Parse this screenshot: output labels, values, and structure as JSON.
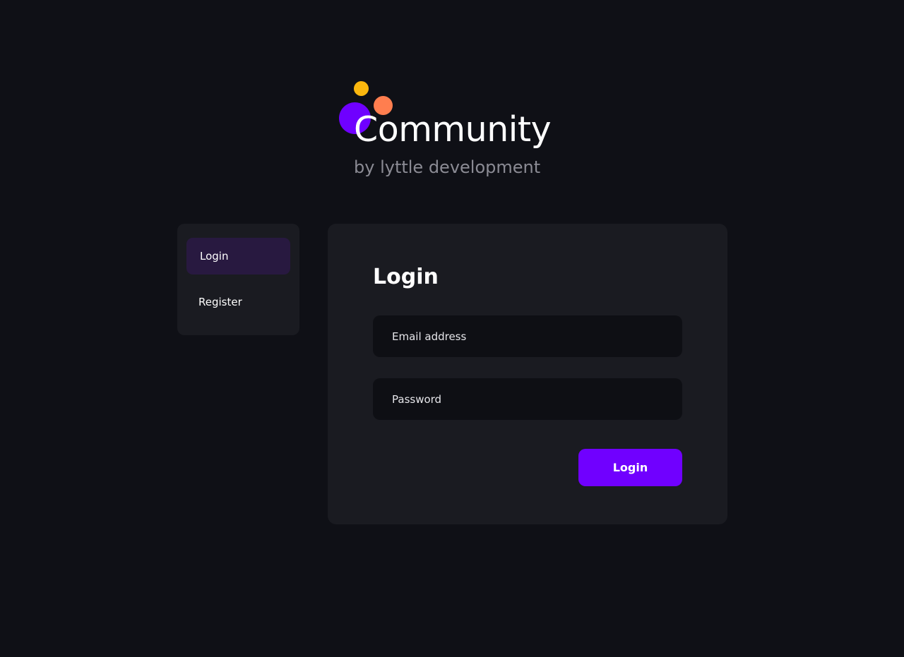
{
  "brand": {
    "title": "Community",
    "subtitle": "by lyttle development",
    "dot_colors": {
      "yellow": "#fbb70e",
      "orange": "#ff7e4f",
      "purple": "#6f00ff"
    }
  },
  "colors": {
    "accent": "#7000ff",
    "nav_active_bg": "#281940",
    "panel_bg": "#1a1b21",
    "page_bg": "#0f1016"
  },
  "sidebar": {
    "items": [
      {
        "label": "Login",
        "active": true
      },
      {
        "label": "Register",
        "active": false
      }
    ]
  },
  "form": {
    "title": "Login",
    "email": {
      "placeholder": "Email address",
      "value": ""
    },
    "password": {
      "placeholder": "Password",
      "value": ""
    },
    "submit_label": "Login"
  }
}
